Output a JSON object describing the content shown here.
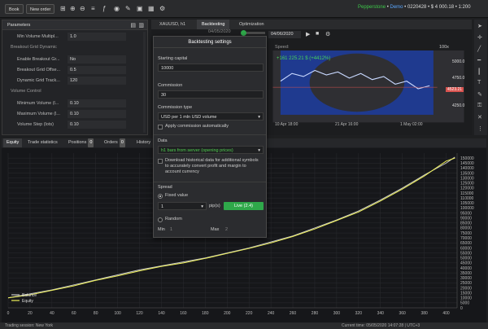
{
  "toolbar": {
    "book_label": "Book",
    "new_order_label": "New order",
    "broker": "Pepperstone",
    "mode": "Demo",
    "account_info": "• 0220428 • $ 4 000.18 • 1:200"
  },
  "parameters": {
    "title": "Parameters",
    "rows": [
      {
        "label": "Min Volume Multipl...",
        "value": "1.0"
      },
      {
        "label": "Enable Breakout Gr...",
        "value": "No"
      },
      {
        "label": "Breakout Grid Offse...",
        "value": "0.5"
      },
      {
        "label": "Dynamic Grid Track...",
        "value": "120"
      },
      {
        "label": "Minimum Volume (l...",
        "value": "0.10"
      },
      {
        "label": "Maximum Volume (l...",
        "value": "0.10"
      },
      {
        "label": "Volume Step (lots)",
        "value": "0.10"
      }
    ],
    "section_breakout": "Breakout Grid Dynamic",
    "section_volume": "Volume Control"
  },
  "chart_tabs": {
    "symbol": "XAUUSD, h1",
    "backtesting": "Backtesting",
    "optimization": "Optimization"
  },
  "chart_header": {
    "start_date": "04/05/2020",
    "end_date": "04/06/2020",
    "speed_label": "Speed:",
    "zoom": "100x"
  },
  "mini_chart": {
    "gain_label": "+161 225.21 $ (+4412%)",
    "price_labels": [
      "5000.0",
      "4750.0",
      "4500.0",
      "4250.0"
    ],
    "highlight_price": "4523.21",
    "dates": [
      "10 Apr 18:00",
      "21 Apr 16:00",
      "1 May 02:00"
    ]
  },
  "bottom_tabs": {
    "equity": "Equity",
    "trade_statistics": "Trade statistics",
    "positions": "Positions",
    "positions_count": "0",
    "orders": "Orders",
    "orders_count": "0",
    "history": "History"
  },
  "modal": {
    "title": "Backtesting settings",
    "starting_capital_label": "Starting capital",
    "starting_capital_value": "10000",
    "commission_label": "Commission",
    "commission_value": "30",
    "commission_type_label": "Commission type",
    "commission_type_value": "USD per 1 mln USD volume",
    "apply_commission_label": "Apply commission automatically",
    "data_label": "Data",
    "data_value": "h1 bars from server (opening prices)",
    "download_label": "Download historical data for additional symbols to accurately convert profit and margin to account currency",
    "spread_label": "Spread",
    "fixed_label": "Fixed value",
    "fixed_value": "1",
    "pips_label": "pip(s)",
    "live_label": "Live (2.4)",
    "random_label": "Random",
    "min_label": "Min",
    "min_value": "1",
    "max_label": "Max",
    "max_value": "2"
  },
  "status": {
    "left": "Trading session: New York",
    "right": "Current time: 05/05/2020 14:07:28 | UTC+3"
  },
  "chart_data": {
    "type": "line",
    "legend": [
      "Balance",
      "Equity"
    ],
    "xlim": [
      0,
      410
    ],
    "ylim": [
      0,
      155000
    ],
    "x_ticks": [
      0,
      20,
      40,
      60,
      80,
      100,
      120,
      140,
      160,
      180,
      200,
      220,
      240,
      260,
      280,
      300,
      320,
      340,
      360,
      380,
      400
    ],
    "y_ticks": [
      0,
      5000,
      10000,
      15000,
      20000,
      25000,
      30000,
      35000,
      40000,
      45000,
      50000,
      55000,
      60000,
      65000,
      70000,
      75000,
      80000,
      85000,
      90000,
      95000,
      100000,
      105000,
      110000,
      115000,
      120000,
      125000,
      130000,
      135000,
      140000,
      145000,
      150000
    ],
    "series": [
      {
        "name": "Balance",
        "color": "#c9c9c9",
        "x": [
          0,
          20,
          40,
          60,
          80,
          100,
          120,
          140,
          160,
          180,
          200,
          220,
          240,
          260,
          280,
          300,
          320,
          340,
          360,
          380,
          400,
          408
        ],
        "y": [
          10000,
          14000,
          18000,
          23000,
          28000,
          33000,
          38000,
          42000,
          46000,
          50000,
          55000,
          60000,
          66000,
          72000,
          80000,
          88000,
          97000,
          108000,
          120000,
          133000,
          145000,
          151000
        ]
      },
      {
        "name": "Equity",
        "color": "#f0f25a",
        "x": [
          0,
          20,
          40,
          60,
          80,
          100,
          120,
          140,
          160,
          180,
          200,
          220,
          240,
          260,
          280,
          300,
          320,
          340,
          360,
          380,
          400,
          408
        ],
        "y": [
          10000,
          13000,
          17500,
          22000,
          27500,
          32000,
          37000,
          41500,
          45000,
          49500,
          54500,
          59500,
          65000,
          71500,
          79000,
          87500,
          96000,
          107000,
          119000,
          132000,
          147000,
          150000
        ]
      }
    ]
  }
}
